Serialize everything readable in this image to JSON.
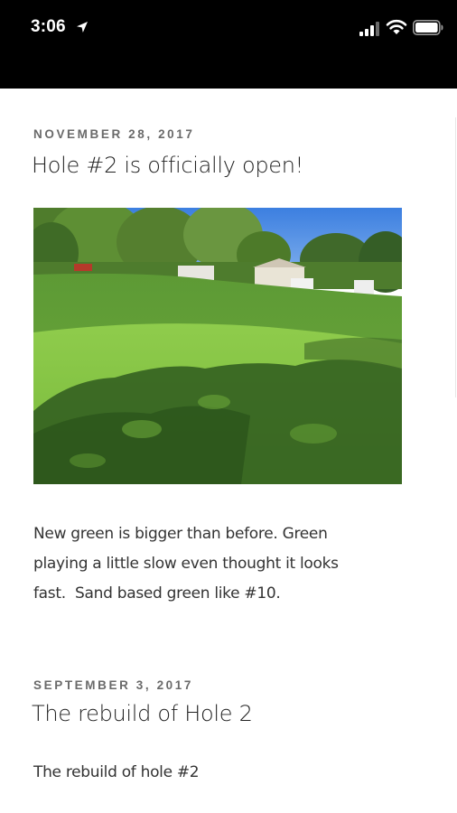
{
  "status_bar": {
    "time": "3:06",
    "icons": [
      "location-arrow-icon",
      "cellular-signal-icon",
      "wifi-icon",
      "battery-icon"
    ]
  },
  "posts": [
    {
      "date": "NOVEMBER 28, 2017",
      "title": "Hole #2 is officially open!",
      "image": "golf-green-photo",
      "body": "New green is bigger than before. Green\nplaying a little slow even thought it looks\nfast.  Sand based green like #10."
    },
    {
      "date": "SEPTEMBER 3, 2017",
      "title": "The rebuild of Hole 2",
      "body": "The rebuild of hole #2"
    }
  ]
}
